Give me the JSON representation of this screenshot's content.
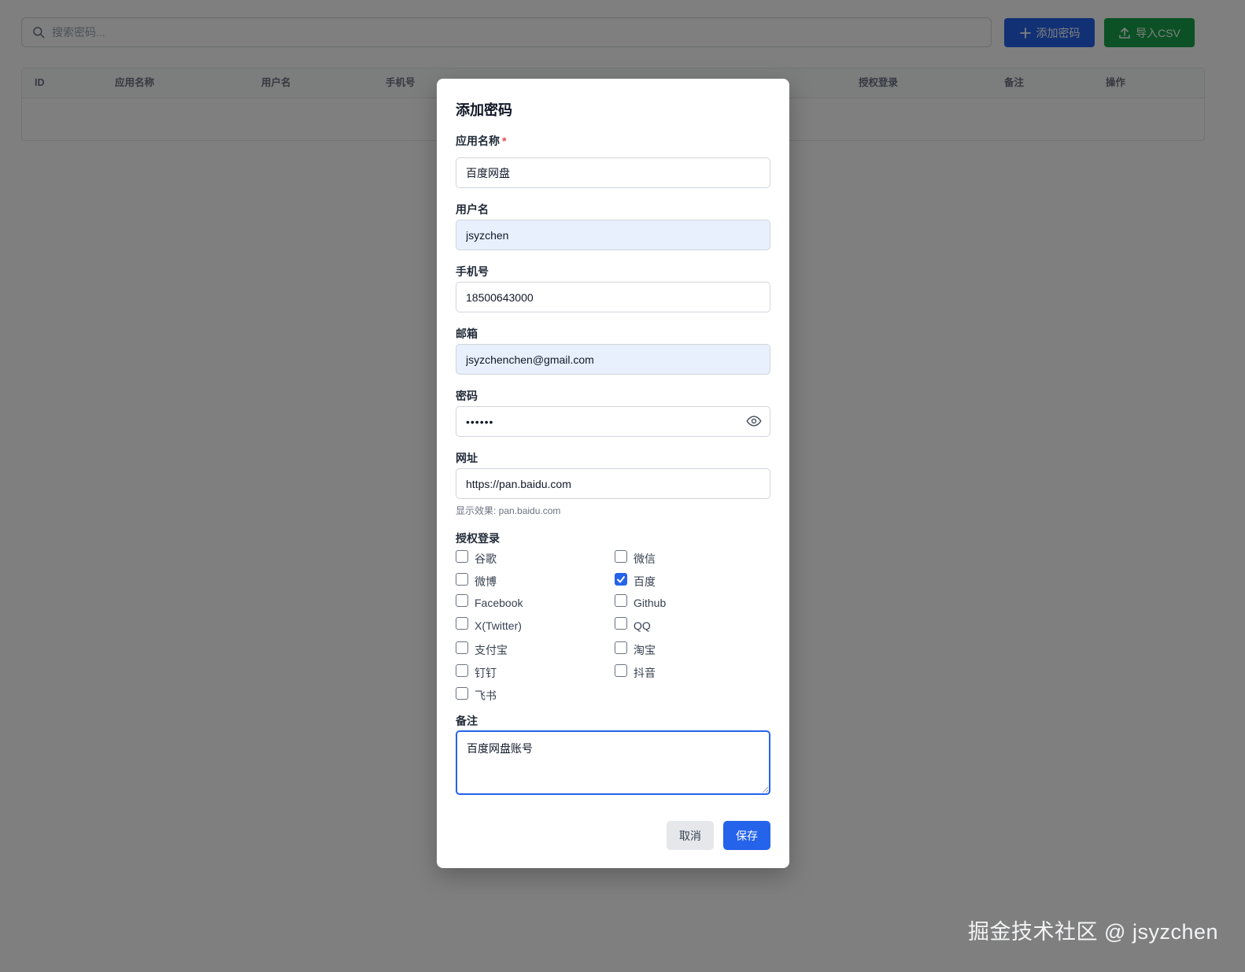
{
  "toolbar": {
    "search_placeholder": "搜索密码...",
    "add_label": "添加密码",
    "import_label": "导入CSV",
    "add_icon": "plus-icon",
    "import_icon": "upload-icon"
  },
  "table": {
    "headers": [
      "ID",
      "应用名称",
      "用户名",
      "手机号",
      "",
      "",
      "",
      "授权登录",
      "备注",
      "操作"
    ]
  },
  "modal": {
    "title": "添加密码",
    "app_name": {
      "label": "应用名称",
      "required_mark": "*",
      "value": "百度网盘"
    },
    "username": {
      "label": "用户名",
      "value": "jsyzchen"
    },
    "phone": {
      "label": "手机号",
      "value": "18500643000"
    },
    "email": {
      "label": "邮箱",
      "value": "jsyzchenchen@gmail.com"
    },
    "password": {
      "label": "密码",
      "value": "••••••",
      "toggle_icon": "eye-icon"
    },
    "url": {
      "label": "网址",
      "value": "https://pan.baidu.com",
      "hint": "显示效果: pan.baidu.com"
    },
    "auth": {
      "label": "授权登录",
      "options": [
        {
          "label": "谷歌",
          "checked": false
        },
        {
          "label": "微信",
          "checked": false
        },
        {
          "label": "微博",
          "checked": false
        },
        {
          "label": "百度",
          "checked": true
        },
        {
          "label": "Facebook",
          "checked": false
        },
        {
          "label": "Github",
          "checked": false
        },
        {
          "label": "X(Twitter)",
          "checked": false
        },
        {
          "label": "QQ",
          "checked": false
        },
        {
          "label": "支付宝",
          "checked": false
        },
        {
          "label": "淘宝",
          "checked": false
        },
        {
          "label": "钉钉",
          "checked": false
        },
        {
          "label": "抖音",
          "checked": false
        },
        {
          "label": "飞书",
          "checked": false
        }
      ]
    },
    "note": {
      "label": "备注",
      "value": "百度网盘账号"
    },
    "cancel_label": "取消",
    "save_label": "保存"
  },
  "watermark": "掘金技术社区 @ jsyzchen",
  "colors": {
    "primary": "#2563eb",
    "success": "#16a34a",
    "required": "#ef4444",
    "autofill": "#e8f0fe"
  }
}
